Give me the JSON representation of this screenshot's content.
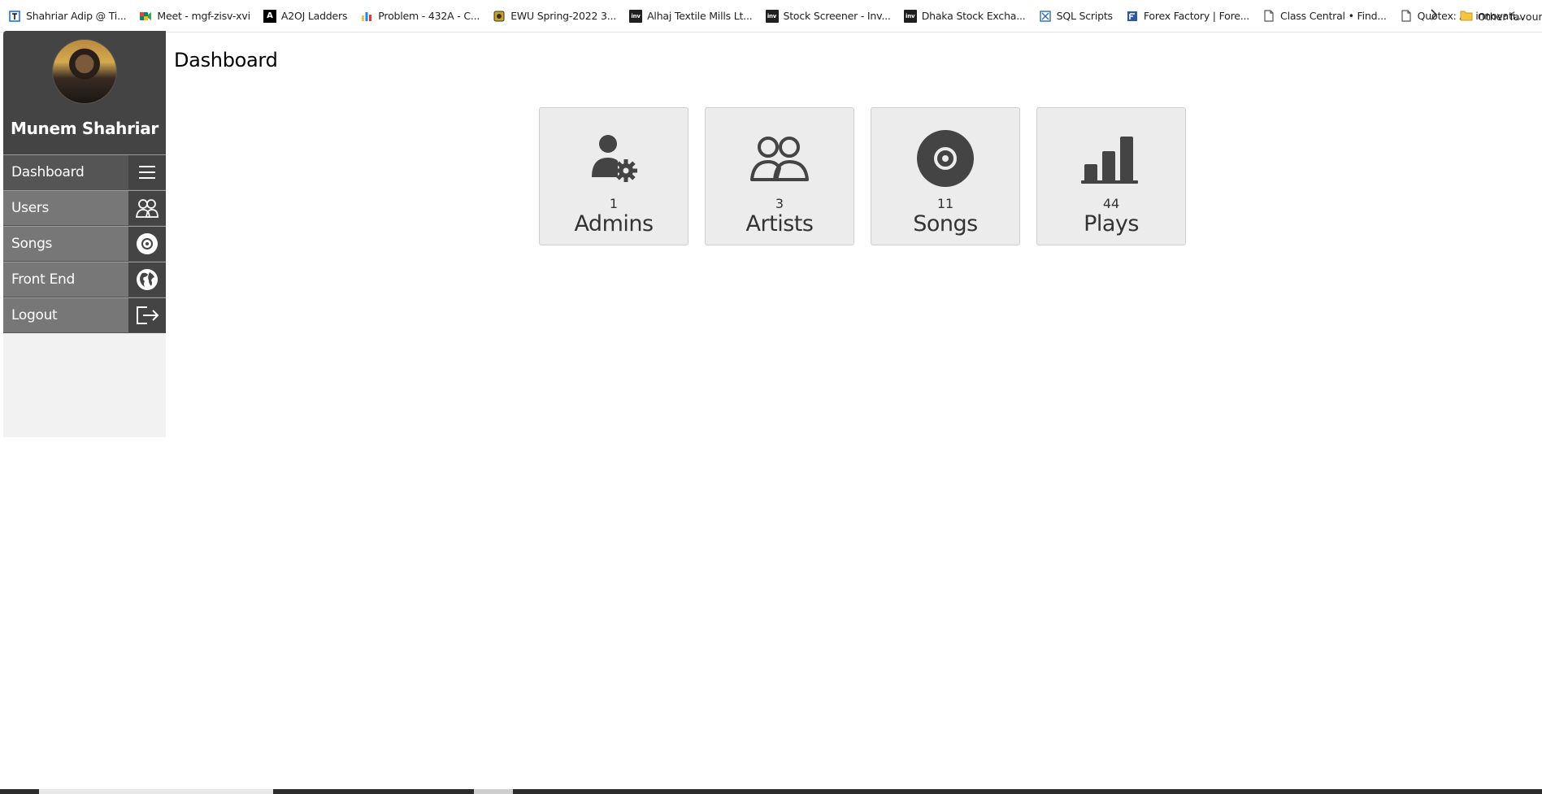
{
  "bookmarks": [
    {
      "label": "Shahriar Adip @ Ti...",
      "icon": "pinned-tab-icon",
      "color": "#1a73e8"
    },
    {
      "label": "Meet - mgf-zisv-xvi",
      "icon": "google-meet-icon",
      "color": "#00897b"
    },
    {
      "label": "A2OJ Ladders",
      "icon": "a2oj-icon",
      "color": "#000000"
    },
    {
      "label": "Problem - 432A - C...",
      "icon": "codeforces-icon",
      "color": "#1e88e5"
    },
    {
      "label": "EWU Spring-2022 3...",
      "icon": "ewu-icon",
      "color": "#c9a227"
    },
    {
      "label": "Alhaj Textile Mills Lt...",
      "icon": "investing-icon",
      "color": "#1f1f1f"
    },
    {
      "label": "Stock Screener - Inv...",
      "icon": "investing-icon",
      "color": "#1f1f1f"
    },
    {
      "label": "Dhaka Stock Excha...",
      "icon": "investing-icon",
      "color": "#1f1f1f"
    },
    {
      "label": "SQL Scripts",
      "icon": "sql-icon",
      "color": "#2b6cb0"
    },
    {
      "label": "Forex Factory | Fore...",
      "icon": "forex-factory-icon",
      "color": "#2c5aa0"
    },
    {
      "label": "Class Central • Find...",
      "icon": "page-icon",
      "color": "#555555"
    },
    {
      "label": "Quotex: An innovati...",
      "icon": "page-icon",
      "color": "#555555"
    }
  ],
  "bookmarks_other": "Other favourit",
  "inv_text": "inv",
  "sidebar": {
    "profile_name": "Munem Shahriar",
    "items": [
      {
        "label": "Dashboard",
        "icon": "menu-icon"
      },
      {
        "label": "Users",
        "icon": "users-icon"
      },
      {
        "label": "Songs",
        "icon": "disc-icon"
      },
      {
        "label": "Front End",
        "icon": "globe-icon"
      },
      {
        "label": "Logout",
        "icon": "logout-icon"
      }
    ]
  },
  "main": {
    "title": "Dashboard",
    "cards": [
      {
        "count": "1",
        "label": "Admins",
        "icon": "admin-icon"
      },
      {
        "count": "3",
        "label": "Artists",
        "icon": "users-icon"
      },
      {
        "count": "11",
        "label": "Songs",
        "icon": "disc-icon"
      },
      {
        "count": "44",
        "label": "Plays",
        "icon": "bar-chart-icon"
      }
    ]
  },
  "colors": {
    "sidebar_dark": "#444444",
    "nav_item": "#777777",
    "card_bg": "#ececec",
    "icon_dark": "#444444"
  }
}
